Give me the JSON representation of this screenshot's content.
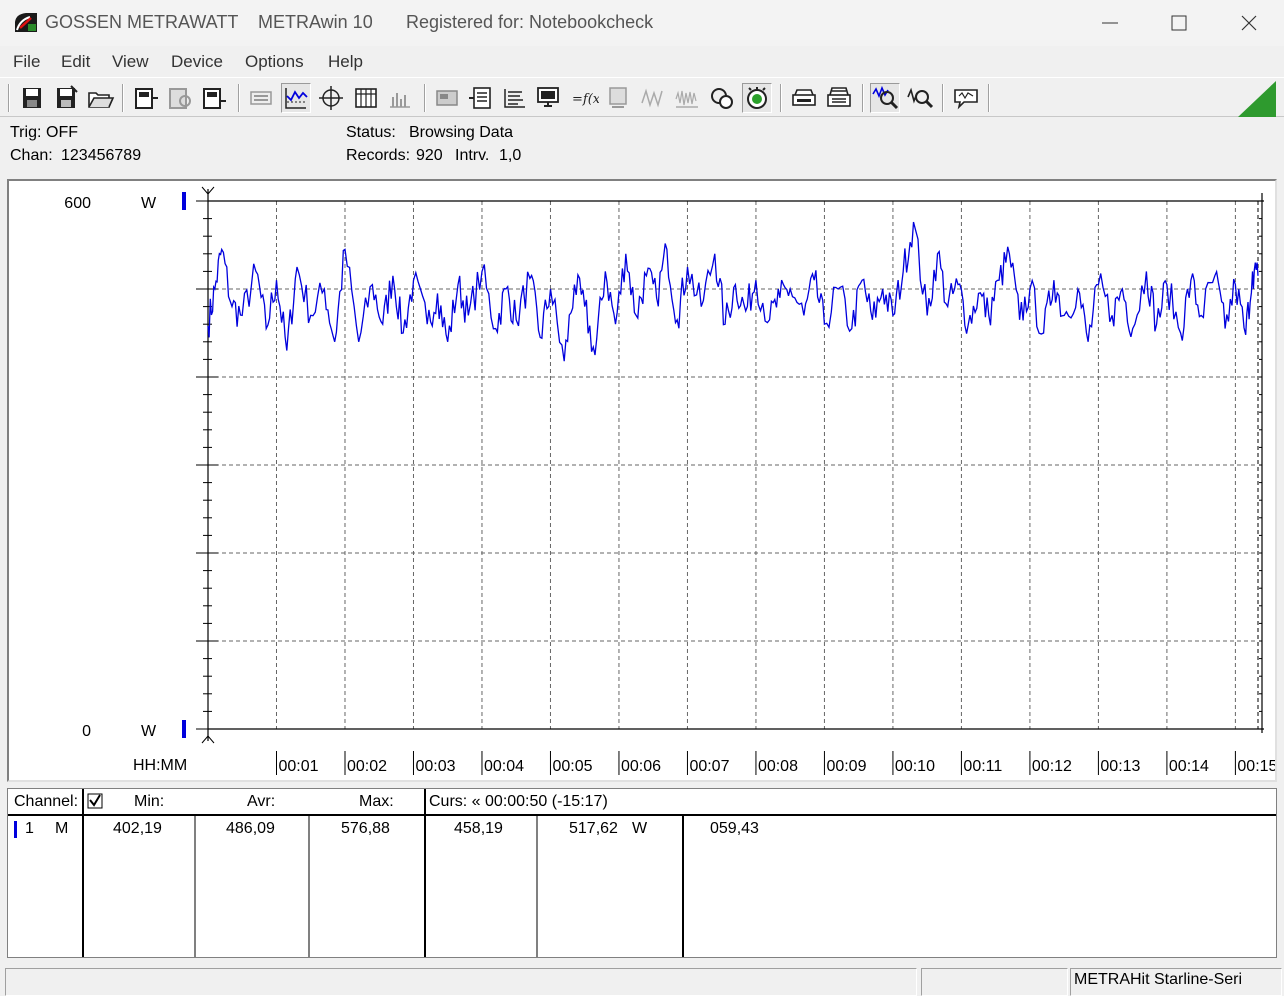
{
  "window": {
    "brand": "GOSSEN METRAWATT",
    "app_name": "METRAwin 10",
    "registered": "Registered for: Notebookcheck"
  },
  "menu": [
    "File",
    "Edit",
    "View",
    "Device",
    "Options",
    "Help"
  ],
  "toolbar": {
    "buttons": [
      "save-disk-icon",
      "save-as-disk-icon",
      "open-folder-icon",
      "device-read-icon",
      "device-settings-icon",
      "device-write-icon",
      "print-preview-icon",
      "graph-view-icon",
      "crosshair-icon",
      "table-view-icon",
      "bar-view-icon",
      "memory-icon",
      "transfer-icon",
      "protocol-icon",
      "monitor-icon",
      "formula-icon",
      "meter-icon",
      "wave-icon",
      "noise-icon",
      "refresh-icon",
      "timer-icon",
      "print-icon",
      "print-all-icon",
      "zoom-in-icon",
      "zoom-out-icon",
      "comment-icon"
    ]
  },
  "info": {
    "trig_label": "Trig:",
    "trig_value": "OFF",
    "chan_label": "Chan:",
    "chan_value": "123456789",
    "status_label": "Status:",
    "status_value": "Browsing Data",
    "records_label": "Records:",
    "records_value": "920",
    "interval_label": "Intrv.",
    "interval_value": "1,0"
  },
  "chart_data": {
    "type": "line",
    "y_max_label": "600",
    "y_min_label": "0",
    "y_unit": "W",
    "ylim": [
      0,
      600
    ],
    "x_axis_label": "HH:MM",
    "x_tick_labels": [
      "00:01",
      "00:02",
      "00:03",
      "00:04",
      "00:05",
      "00:06",
      "00:07",
      "00:08",
      "00:09",
      "00:10",
      "00:11",
      "00:12",
      "00:13",
      "00:14",
      "00:15"
    ],
    "xlim_minutes": [
      0,
      15.33
    ],
    "line_color": "#0000dd",
    "grid": true,
    "series": [
      {
        "x_minutes": [
          0,
          0.1,
          0.2,
          0.35,
          0.5,
          0.7,
          0.85,
          1.0,
          1.15,
          1.3,
          1.5,
          1.7,
          1.85,
          2.0,
          2.2,
          2.4,
          2.55,
          2.7,
          2.85,
          3.0,
          3.2,
          3.35,
          3.5,
          3.65,
          3.8,
          4.0,
          4.2,
          4.35,
          4.5,
          4.7,
          4.85,
          5.0,
          5.2,
          5.35,
          5.5,
          5.65,
          5.8,
          5.95,
          6.1,
          6.25,
          6.4,
          6.55,
          6.7,
          6.85,
          7.0,
          7.2,
          7.4,
          7.55,
          7.7,
          7.85,
          8.0,
          8.2,
          8.35,
          8.5,
          8.7,
          8.85,
          9.0,
          9.2,
          9.4,
          9.55,
          9.7,
          9.85,
          10.0,
          10.15,
          10.3,
          10.5,
          10.65,
          10.8,
          10.95,
          11.1,
          11.25,
          11.4,
          11.55,
          11.7,
          11.85,
          12.0,
          12.2,
          12.35,
          12.5,
          12.7,
          12.85,
          13.0,
          13.2,
          13.35,
          13.5,
          13.7,
          13.85,
          14.0,
          14.2,
          14.35,
          14.5,
          14.7,
          14.85,
          15.0,
          15.15,
          15.25,
          15.33
        ],
        "values": [
          458,
          500,
          545,
          480,
          470,
          520,
          455,
          510,
          430,
          525,
          470,
          500,
          440,
          545,
          440,
          505,
          460,
          515,
          450,
          510,
          460,
          495,
          440,
          505,
          470,
          520,
          455,
          500,
          465,
          512,
          445,
          500,
          418,
          505,
          480,
          425,
          520,
          460,
          540,
          470,
          515,
          490,
          545,
          465,
          525,
          480,
          540,
          460,
          505,
          475,
          510,
          465,
          490,
          500,
          470,
          510,
          460,
          500,
          455,
          510,
          465,
          500,
          470,
          520,
          576,
          470,
          540,
          480,
          505,
          460,
          495,
          470,
          510,
          540,
          465,
          500,
          450,
          510,
          470,
          500,
          440,
          505,
          470,
          500,
          455,
          520,
          460,
          505,
          450,
          510,
          470,
          515,
          455,
          505,
          448,
          520,
          515
        ]
      }
    ]
  },
  "table": {
    "headers": {
      "channel": "Channel:",
      "min": "Min:",
      "avr": "Avr:",
      "max": "Max:",
      "cursor": "Curs: « 00:00:50 (-15:17)"
    },
    "rows": [
      {
        "channel": "1",
        "mode": "M",
        "min": "402,19",
        "avr": "486,09",
        "max": "576,88",
        "cursor_value": "458,19",
        "value2": "517,62",
        "unit": "W",
        "value3": "059,43"
      }
    ]
  },
  "statusbar": {
    "device": "METRAHit Starline-Seri"
  }
}
